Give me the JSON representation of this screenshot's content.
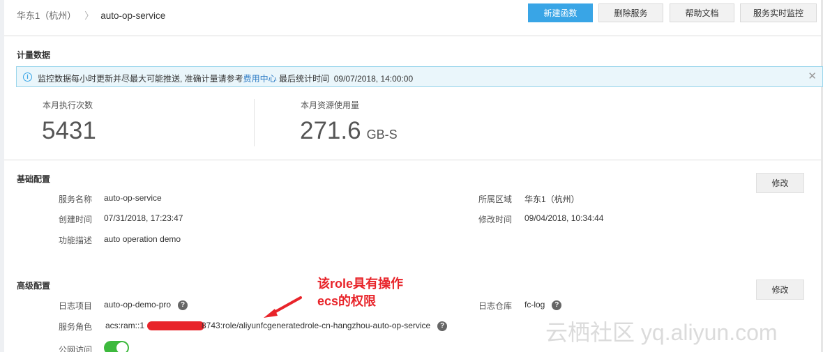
{
  "header": {
    "region": "华东1（杭州）",
    "separator": "〉",
    "service": "auto-op-service",
    "buttons": {
      "new_function": "新建函数",
      "delete_service": "删除服务",
      "help_docs": "帮助文档",
      "realtime_monitor": "服务实时监控"
    }
  },
  "metering": {
    "title": "计量数据",
    "notice_prefix": "监控数据每小时更新并尽最大可能推送, 准确计量请参考",
    "notice_link": "费用中心",
    "notice_suffix": "最后统计时间",
    "notice_time": "09/07/2018, 14:00:00",
    "info_icon": "i",
    "close_icon": "✕",
    "invocations_label": "本月执行次数",
    "invocations_value": "5431",
    "resource_label": "本月资源使用量",
    "resource_value": "271.6",
    "resource_unit": "GB-S"
  },
  "basic": {
    "title": "基础配置",
    "edit": "修改",
    "service_name_label": "服务名称",
    "service_name": "auto-op-service",
    "region_label": "所属区域",
    "region": "华东1（杭州）",
    "created_label": "创建时间",
    "created": "07/31/2018, 17:23:47",
    "modified_label": "修改时间",
    "modified": "09/04/2018, 10:34:44",
    "desc_label": "功能描述",
    "desc": "auto operation demo"
  },
  "advanced": {
    "title": "高级配置",
    "edit": "修改",
    "log_project_label": "日志项目",
    "log_project": "auto-op-demo-pro",
    "logstore_label": "日志仓库",
    "logstore": "fc-log",
    "role_label": "服务角色",
    "role_prefix": "acs:ram::1",
    "role_suffix": "8743:role/aliyunfcgeneratedrole-cn-hangzhou-auto-op-service",
    "internet_label": "公网访问",
    "help_icon": "?"
  },
  "annotation": {
    "line1": "该role具有操作",
    "line2": "ecs的权限"
  },
  "watermark": "云栖社区 yq.aliyun.com",
  "colors": {
    "primary": "#39a5e6",
    "annotation": "#e8242a",
    "toggle_on": "#3db93d"
  }
}
